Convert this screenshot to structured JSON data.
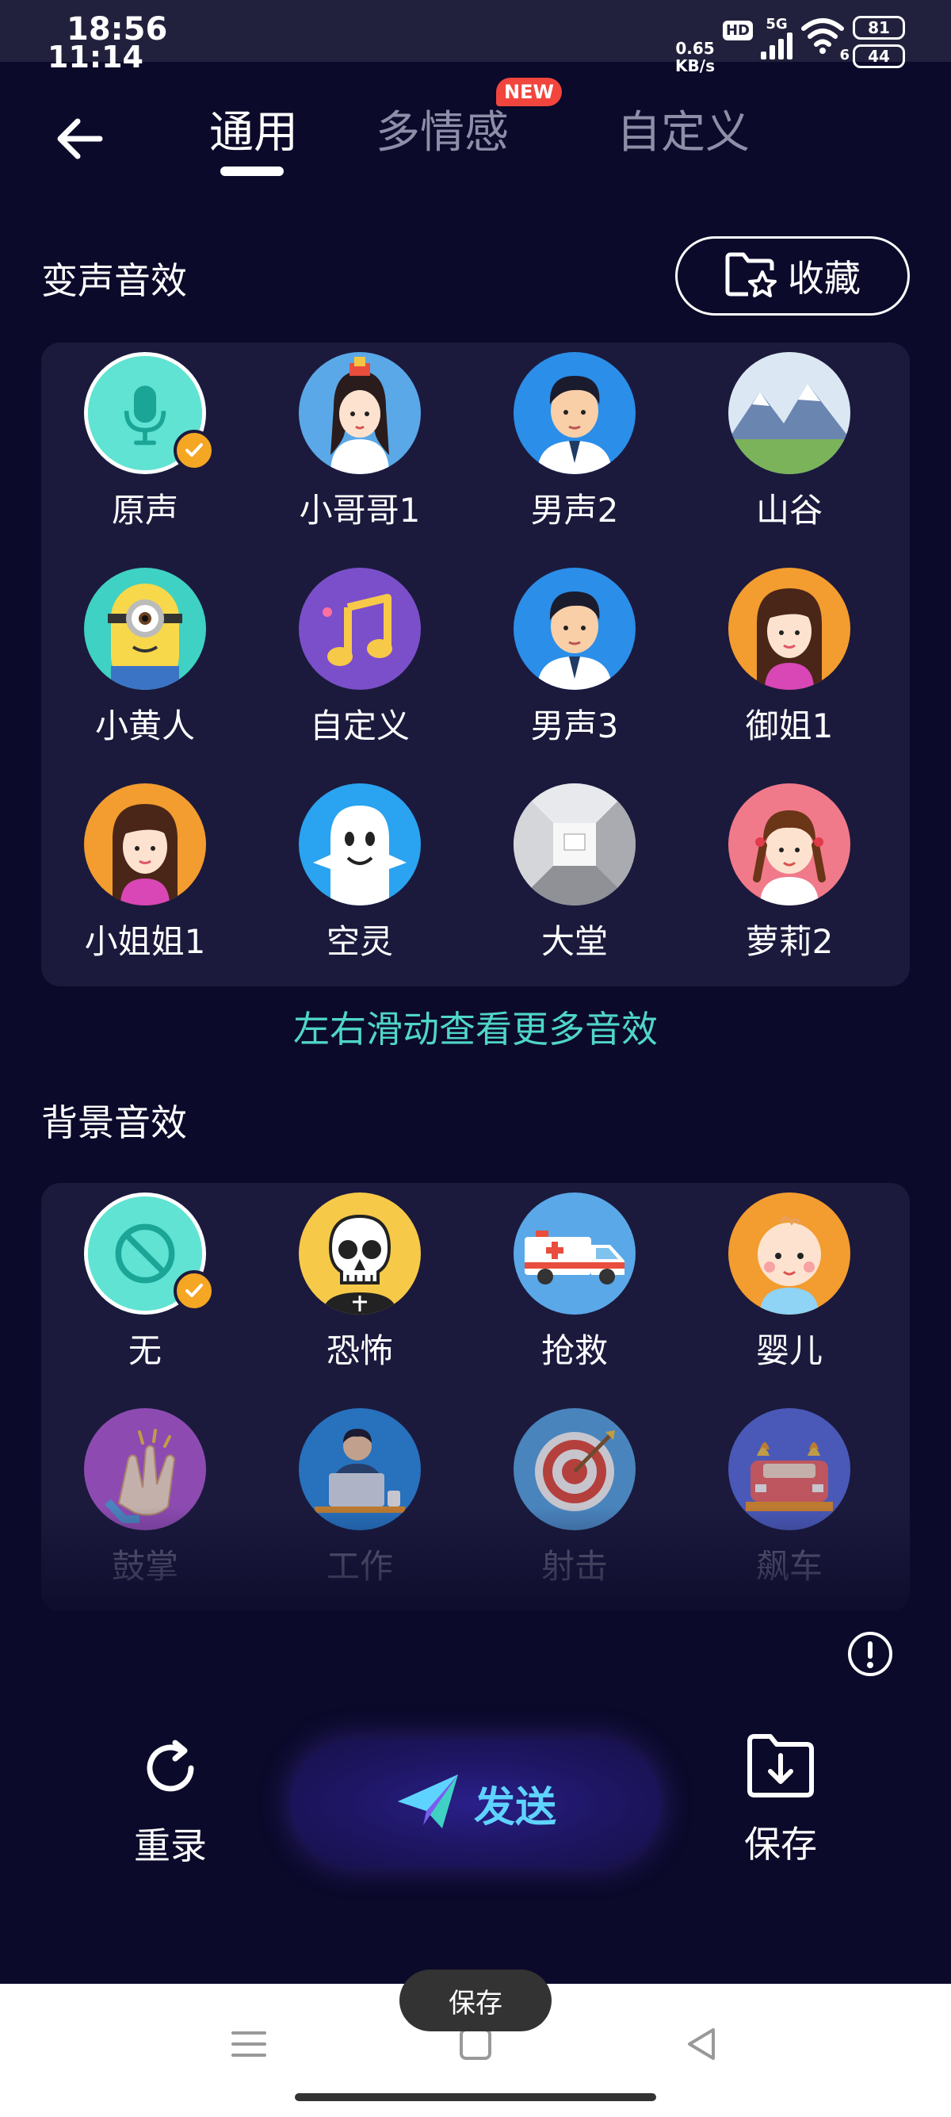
{
  "status_bar": {
    "time_primary": "18:56",
    "time_secondary": "11:14",
    "net_speed": "0.65",
    "net_unit": "KB/s",
    "hd": "HD",
    "network": "5G",
    "wifi_num": "6",
    "battery_a": "81",
    "battery_b": "44"
  },
  "tabs": [
    {
      "label": "通用",
      "active": true
    },
    {
      "label": "多情感",
      "badge": "NEW"
    },
    {
      "label": "自定义"
    }
  ],
  "voice_section": {
    "title": "变声音效",
    "favorites_label": "收藏",
    "items": [
      {
        "label": "原声",
        "icon": "microphone-icon",
        "selected": true
      },
      {
        "label": "小哥哥1",
        "icon": "ancient-boy-avatar"
      },
      {
        "label": "男声2",
        "icon": "man-avatar"
      },
      {
        "label": "山谷",
        "icon": "mountain-landscape"
      },
      {
        "label": "小黄人",
        "icon": "minion-avatar"
      },
      {
        "label": "自定义",
        "icon": "music-note-icon"
      },
      {
        "label": "男声3",
        "icon": "man-avatar"
      },
      {
        "label": "御姐1",
        "icon": "woman-avatar"
      },
      {
        "label": "小姐姐1",
        "icon": "woman-avatar"
      },
      {
        "label": "空灵",
        "icon": "ghost-avatar"
      },
      {
        "label": "大堂",
        "icon": "hall-interior"
      },
      {
        "label": "萝莉2",
        "icon": "girl-avatar"
      }
    ]
  },
  "hint": "左右滑动查看更多音效",
  "background_section": {
    "title": "背景音效",
    "items": [
      {
        "label": "无",
        "icon": "none-icon",
        "selected": true
      },
      {
        "label": "恐怖",
        "icon": "skull-icon"
      },
      {
        "label": "抢救",
        "icon": "ambulance-icon"
      },
      {
        "label": "婴儿",
        "icon": "baby-avatar"
      },
      {
        "label": "鼓掌",
        "icon": "clapping-hands-icon"
      },
      {
        "label": "工作",
        "icon": "worker-laptop-icon"
      },
      {
        "label": "射击",
        "icon": "target-icon"
      },
      {
        "label": "飙车",
        "icon": "race-car-icon"
      }
    ]
  },
  "actions": {
    "rerecord": "重录",
    "send": "发送",
    "save": "保存"
  },
  "toast": "保存",
  "colors": {
    "background": "#0b0a2a",
    "panel": "#1b1a3d",
    "accent_check": "#f5a623",
    "hint": "#4fd6c8",
    "send_text": "#5fd3ff",
    "new_badge": "#f2453d"
  }
}
